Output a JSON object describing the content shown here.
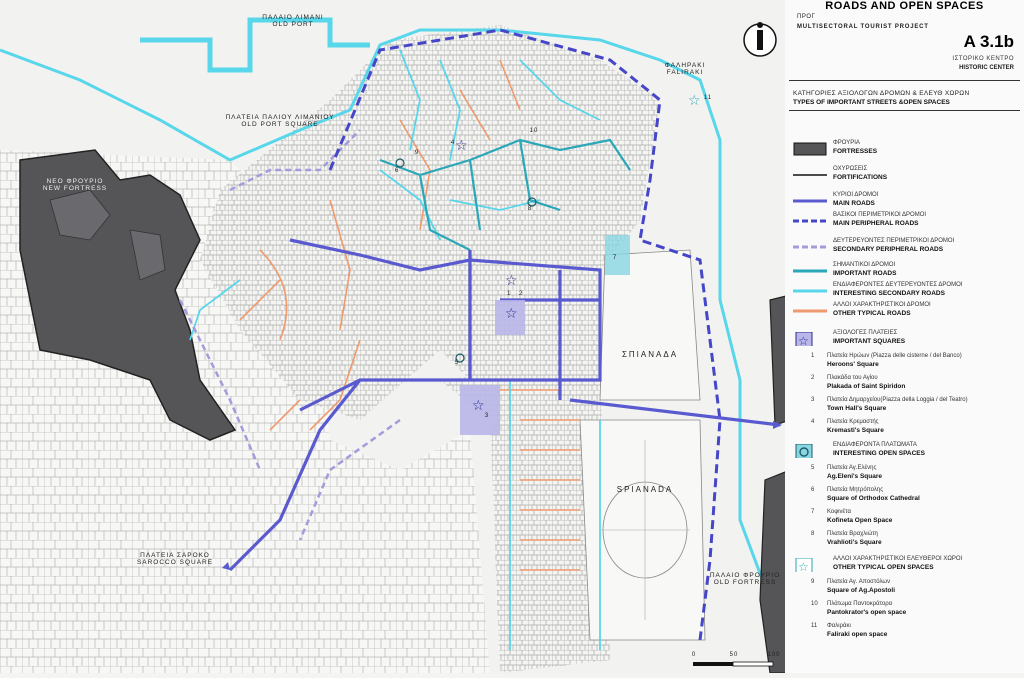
{
  "header": {
    "title": "ROADS AND OPEN SPACES",
    "program": "ΠΡΟΓ",
    "project": "MULTISECTORAL TOURIST PROJECT",
    "code": "A 3.1b",
    "area_gr": "ΙΣΤΟΡΙΚΟ ΚΕΝΤΡΟ",
    "area_en": "HISTORIC CENTER",
    "subtitle_gr": "ΚΑΤΗΓΟΡΙΕΣ ΑΞΙΟΛΟΓΩΝ ΔΡΟΜΩΝ & ΕΛΕΥΘ ΧΩΡΩΝ",
    "subtitle_en": "TYPES OF IMPORTANT STREETS &OPEN SPACES"
  },
  "legend": {
    "categories": [
      {
        "gr": "ΦΡΟΥΡΙΑ",
        "en": "FORTRESSES",
        "symbol": "fortress-fill"
      },
      {
        "gr": "ΟΧΥΡΩΣΕΙΣ",
        "en": "FORTIFICATIONS",
        "symbol": "black-line"
      },
      {
        "gr": "ΚΥΡΙΟΙ ΔΡΟΜΟΙ",
        "en": "MAIN ROADS",
        "symbol": "blue-thick"
      },
      {
        "gr": "ΒΑΣΙΚΟΙ ΠΕΡΙΜΕΤΡΙΚΟΙ ΔΡΟΜΟΙ",
        "en": "MAIN PERIPHERAL ROADS",
        "symbol": "blue-dashed"
      },
      {
        "gr": "ΔΕΥΤΕΡΕΥΟΝΤΕΣ ΠΕΡΙΜΕΤΡΙΚΟΙ ΔΡΟΜΟΙ",
        "en": "SECONDARY PERIPHERAL ROADS",
        "symbol": "lavender-dashed"
      },
      {
        "gr": "ΣΗΜΑΝΤΙΚΟΙ ΔΡΟΜΟΙ",
        "en": "IMPORTANT ROADS",
        "symbol": "teal-line"
      },
      {
        "gr": "ΕΝΔΙΑΦΕΡΟΝΤΕΣ ΔΕΥΤΕΡΕΥΟΝΤΕΣ ΔΡΟΜΟΙ",
        "en": "INTERESTING SECONDARY ROADS",
        "symbol": "cyan-line"
      },
      {
        "gr": "ΑΛΛΟΙ ΧΑΡΑΚΤΗΡΙΣΤΙΚΟΙ ΔΡΟΜΟΙ",
        "en": "OTHER TYPICAL ROADS",
        "symbol": "orange-line"
      }
    ],
    "squares_group": {
      "gr": "ΑΞΙΟΛΟΓΕΣ ΠΛΑΤΕΙΕΣ",
      "en": "IMPORTANT SQUARES",
      "symbol": "star-square-icon"
    },
    "squares": [
      {
        "n": "1",
        "gr": "Πλατεία Ηρώων   (Piazza delle cisterne / del Banco)",
        "en": "Heroons' Square"
      },
      {
        "n": "2",
        "gr": "Πλακάδα του Αγίου",
        "en": "Plakada of Saint Spiridon"
      },
      {
        "n": "3",
        "gr": "Πλατεία Δημαρχείου(Piazza della Loggia / del Teatro)",
        "en": "Town Hall's Square"
      },
      {
        "n": "4",
        "gr": "Πλατεία Κρεμαστής",
        "en": "Kremasti's Square"
      }
    ],
    "open_group": {
      "gr": "ΕΝΔΙΑΦΕΡΟΝΤΑ ΠΛΑΤΩΜΑΤΑ",
      "en": "INTERESTING OPEN SPACES",
      "symbol": "circle-square-icon"
    },
    "open_spaces": [
      {
        "n": "5",
        "gr": "Πλατεία Αγ.Ελένης",
        "en": "Ag.Eleni's Square"
      },
      {
        "n": "6",
        "gr": "Πλατεία Μητρόπολης",
        "en": "Square of Orthodox Cathedral"
      },
      {
        "n": "7",
        "gr": "Κοφινέτα",
        "en": "Kofineta Open Space"
      },
      {
        "n": "8",
        "gr": "Πλατεία Βραχλιώτη",
        "en": "Vrahlioti's Square"
      }
    ],
    "other_group": {
      "gr": "ΑΛΛΟΙ ΧΑΡΑΚΤΗΡΙΣΤΙΚΟΙ ΕΛΕΥΘΕΡΟΙ ΧΩΡΟΙ",
      "en": "OTHER TYPICAL OPEN SPACES",
      "symbol": "outline-star-icon"
    },
    "other_spaces": [
      {
        "n": "9",
        "gr": "Πλατεία Αγ. Αποστόλων",
        "en": "Square of Ag.Apostoli"
      },
      {
        "n": "10",
        "gr": "Πλάτωμα Παντοκράτορα",
        "en": "Pantokrator's open space"
      },
      {
        "n": "11",
        "gr": "Φαλιράκι",
        "en": "Faliraki open space"
      }
    ]
  },
  "map": {
    "labels": {
      "old_port_gr": "ΠΑΛΑΙΟ ΛΙΜΑΝΙ",
      "old_port_en": "OLD PORT",
      "old_port_sq_gr": "ΠΛΑΤΕΙΑ ΠΑΛΙΟΥ ΛΙΜΑΝΙΟΥ",
      "old_port_sq_en": "OLD PORT SQUARE",
      "new_fort_gr": "ΝΕΟ  ΦΡΟΥΡΙΟ",
      "new_fort_en": "NEW FORTRESS",
      "faliraki_gr": "ΦΑΛΗΡΑΚΙ",
      "faliraki_en": "FALIRAKI",
      "spianada_gr": "ΣΠΙΑΝΑΔΑ",
      "spianada_en": "SPIANADA",
      "old_fort_gr": "ΠΑΛΑΙΟ ΦΡΟΥΡΙΟ",
      "old_fort_en": "OLD FORTRESS",
      "sarocco_gr": "ΠΛΑΤΕΙΑ ΣΑΡΟΚΟ",
      "sarocco_en": "SAROCCO SQUARE"
    },
    "markers": [
      "1",
      "2",
      "3",
      "4",
      "5",
      "6",
      "7",
      "8",
      "9",
      "10",
      "11"
    ],
    "scale": {
      "ticks": [
        "0",
        "50",
        "100"
      ]
    }
  },
  "colors": {
    "main": "#5a5ad0",
    "peripheral": "#4646c8",
    "secondary_peripheral": "#a59bdc",
    "important": "#2aa7b8",
    "interesting": "#58d6ea",
    "typical": "#ef9a6e",
    "fortress": "#555558"
  }
}
